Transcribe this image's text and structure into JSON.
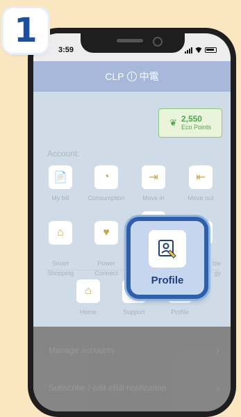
{
  "step_number": "1",
  "status_bar": {
    "time": "3:59"
  },
  "header": {
    "brand": "CLP",
    "brand_cn": "中電"
  },
  "eco_points": {
    "value": "2,550",
    "label": "Eco Points"
  },
  "account_label": "Account:",
  "grid": [
    {
      "label": "My bill"
    },
    {
      "label": "Consumption"
    },
    {
      "label": "Move in"
    },
    {
      "label": "Move out"
    },
    {
      "label": "Smart\nShopping"
    },
    {
      "label": "Power\nConnect"
    },
    {
      "label": ""
    },
    {
      "label": "ble\ngy"
    }
  ],
  "bottom_nav": [
    {
      "label": "Home"
    },
    {
      "label": "Support"
    },
    {
      "label": "Profile"
    }
  ],
  "highlight": {
    "label": "Profile"
  },
  "menu": [
    {
      "label": "Manage accounts"
    },
    {
      "label": "Subscribe / edit eBill notification"
    }
  ]
}
